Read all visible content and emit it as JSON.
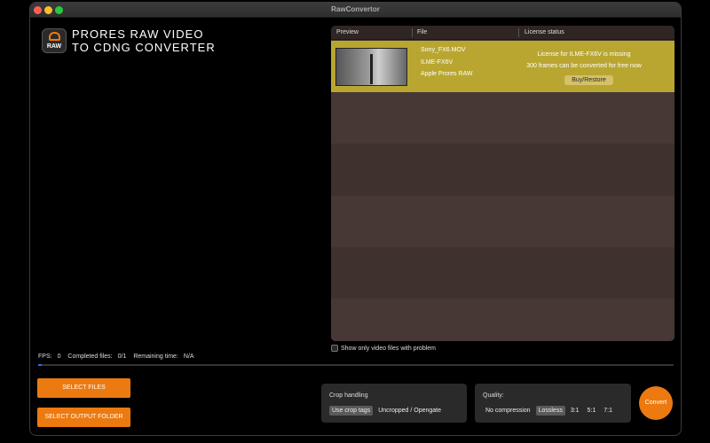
{
  "window": {
    "title": "RawConvertor"
  },
  "app": {
    "logo_text": "RAW",
    "name_line1": "PRORES RAW VIDEO",
    "name_line2": "TO CDNG CONVERTER"
  },
  "table": {
    "headers": [
      "Preview",
      "File",
      "License status"
    ],
    "rows": [
      {
        "file_name": "Sony_FX6.MOV",
        "camera": "ILME-FX6V",
        "codec": "Apple Prores RAW",
        "license_line1": "License for ILME-FX6V is missing",
        "license_line2": "300 frames can be converted for free now",
        "buy_label": "Buy/Restore"
      }
    ]
  },
  "filter": {
    "label": "Show only video files with problem",
    "checked": false
  },
  "stats": {
    "fps_label": "FPS:",
    "fps_value": "0",
    "completed_label": "Completed files:",
    "completed_value": "0/1",
    "remaining_label": "Remaining time:",
    "remaining_value": "N/A"
  },
  "progress": {
    "fraction": 0.005
  },
  "buttons": {
    "select_files": "SELECT FILES",
    "select_output": "SELECT OUTPUT FOLDER",
    "convert": "Convert"
  },
  "crop": {
    "label": "Crop handling",
    "options": [
      "Use crop tags",
      "Uncropped / Opengate"
    ],
    "selected": "Use crop tags"
  },
  "quality": {
    "label": "Quality:",
    "options": [
      "No compression",
      "Lossless",
      "3:1",
      "5:1",
      "7:1"
    ],
    "selected": "Lossless"
  },
  "colors": {
    "accent": "#ec7a10",
    "selected_row": "#b9a631",
    "list_bg": "#3e312e"
  }
}
